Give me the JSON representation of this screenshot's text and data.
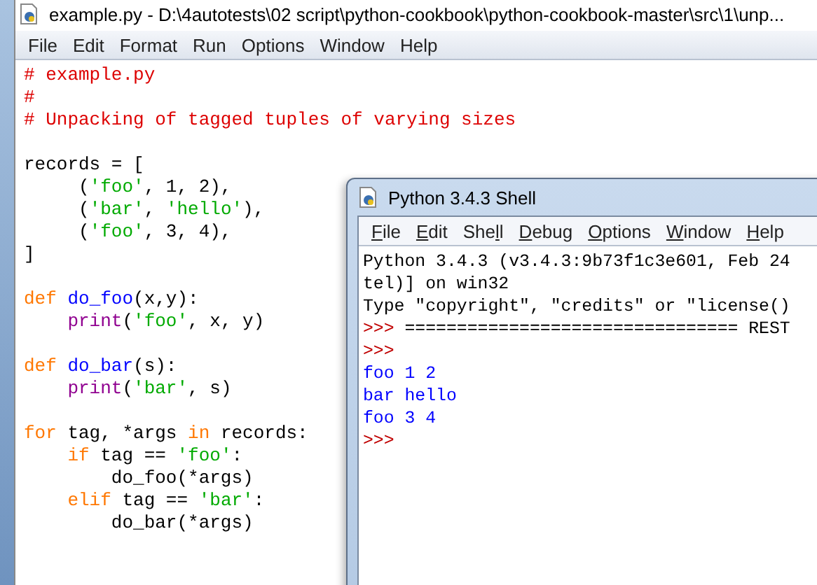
{
  "editor": {
    "title": "example.py - D:\\4autotests\\02 script\\python-cookbook\\python-cookbook-master\\src\\1\\unp...",
    "menu": [
      {
        "label": "File"
      },
      {
        "label": "Edit"
      },
      {
        "label": "Format"
      },
      {
        "label": "Run"
      },
      {
        "label": "Options"
      },
      {
        "label": "Window"
      },
      {
        "label": "Help"
      }
    ],
    "lines": [
      {
        "kind": "code",
        "tokens": [
          {
            "text": "# example.py",
            "kind": "comment"
          }
        ]
      },
      {
        "kind": "code",
        "tokens": [
          {
            "text": "#",
            "kind": "comment"
          }
        ]
      },
      {
        "kind": "code",
        "tokens": [
          {
            "text": "# Unpacking of tagged tuples of varying sizes",
            "kind": "comment"
          }
        ]
      },
      {
        "kind": "blank"
      },
      {
        "kind": "code",
        "tokens": [
          {
            "text": "records = [",
            "kind": "plain"
          }
        ]
      },
      {
        "kind": "code",
        "tokens": [
          {
            "text": "     (",
            "kind": "plain"
          },
          {
            "text": "'foo'",
            "kind": "string"
          },
          {
            "text": ", 1, 2),",
            "kind": "plain"
          }
        ]
      },
      {
        "kind": "code",
        "tokens": [
          {
            "text": "     (",
            "kind": "plain"
          },
          {
            "text": "'bar'",
            "kind": "string"
          },
          {
            "text": ", ",
            "kind": "plain"
          },
          {
            "text": "'hello'",
            "kind": "string"
          },
          {
            "text": "),",
            "kind": "plain"
          }
        ]
      },
      {
        "kind": "code",
        "tokens": [
          {
            "text": "     (",
            "kind": "plain"
          },
          {
            "text": "'foo'",
            "kind": "string"
          },
          {
            "text": ", 3, 4),",
            "kind": "plain"
          }
        ]
      },
      {
        "kind": "code",
        "tokens": [
          {
            "text": "]",
            "kind": "plain"
          }
        ]
      },
      {
        "kind": "blank"
      },
      {
        "kind": "code",
        "tokens": [
          {
            "text": "def ",
            "kind": "keyword"
          },
          {
            "text": "do_foo",
            "kind": "definition"
          },
          {
            "text": "(x,y):",
            "kind": "plain"
          }
        ]
      },
      {
        "kind": "code",
        "tokens": [
          {
            "text": "    print",
            "kind": "builtin"
          },
          {
            "text": "(",
            "kind": "plain"
          },
          {
            "text": "'foo'",
            "kind": "string"
          },
          {
            "text": ", x, y)",
            "kind": "plain"
          }
        ]
      },
      {
        "kind": "blank"
      },
      {
        "kind": "code",
        "tokens": [
          {
            "text": "def ",
            "kind": "keyword"
          },
          {
            "text": "do_bar",
            "kind": "definition"
          },
          {
            "text": "(s):",
            "kind": "plain"
          }
        ]
      },
      {
        "kind": "code",
        "tokens": [
          {
            "text": "    print",
            "kind": "builtin"
          },
          {
            "text": "(",
            "kind": "plain"
          },
          {
            "text": "'bar'",
            "kind": "string"
          },
          {
            "text": ", s)",
            "kind": "plain"
          }
        ]
      },
      {
        "kind": "blank"
      },
      {
        "kind": "code",
        "tokens": [
          {
            "text": "for",
            "kind": "keyword"
          },
          {
            "text": " tag, *args ",
            "kind": "plain"
          },
          {
            "text": "in",
            "kind": "keyword"
          },
          {
            "text": " records:",
            "kind": "plain"
          }
        ]
      },
      {
        "kind": "code",
        "tokens": [
          {
            "text": "    if",
            "kind": "keyword"
          },
          {
            "text": " tag == ",
            "kind": "plain"
          },
          {
            "text": "'foo'",
            "kind": "string"
          },
          {
            "text": ":",
            "kind": "plain"
          }
        ]
      },
      {
        "kind": "code",
        "tokens": [
          {
            "text": "        do_foo(*args)",
            "kind": "plain"
          }
        ]
      },
      {
        "kind": "code",
        "tokens": [
          {
            "text": "    elif",
            "kind": "keyword"
          },
          {
            "text": " tag == ",
            "kind": "plain"
          },
          {
            "text": "'bar'",
            "kind": "string"
          },
          {
            "text": ":",
            "kind": "plain"
          }
        ]
      },
      {
        "kind": "code",
        "tokens": [
          {
            "text": "        do_bar(*args)",
            "kind": "plain"
          }
        ]
      }
    ]
  },
  "shell": {
    "title": "Python 3.4.3 Shell",
    "menu": [
      {
        "key": "F",
        "rest": "ile"
      },
      {
        "key": "E",
        "rest": "dit"
      },
      {
        "lead": "She",
        "key": "l",
        "rest": "l"
      },
      {
        "key": "D",
        "rest": "ebug"
      },
      {
        "key": "O",
        "rest": "ptions"
      },
      {
        "key": "W",
        "rest": "indow"
      },
      {
        "key": "H",
        "rest": "elp"
      }
    ],
    "lines": [
      {
        "tokens": [
          {
            "text": "Python 3.4.3 (v3.4.3:9b73f1c3e601, Feb 24",
            "kind": "plain"
          }
        ]
      },
      {
        "tokens": [
          {
            "text": "tel)] on win32",
            "kind": "plain"
          }
        ]
      },
      {
        "tokens": [
          {
            "text": "Type \"copyright\", \"credits\" or \"license()",
            "kind": "plain"
          }
        ]
      },
      {
        "tokens": [
          {
            "text": ">>>",
            "kind": "prompt"
          },
          {
            "text": " ================================ REST",
            "kind": "plain"
          }
        ]
      },
      {
        "tokens": [
          {
            "text": ">>>",
            "kind": "prompt"
          }
        ]
      },
      {
        "tokens": [
          {
            "text": "foo 1 2",
            "kind": "output"
          }
        ]
      },
      {
        "tokens": [
          {
            "text": "bar hello",
            "kind": "output"
          }
        ]
      },
      {
        "tokens": [
          {
            "text": "foo 3 4",
            "kind": "output"
          }
        ]
      },
      {
        "tokens": [
          {
            "text": ">>>",
            "kind": "prompt"
          }
        ]
      }
    ]
  }
}
